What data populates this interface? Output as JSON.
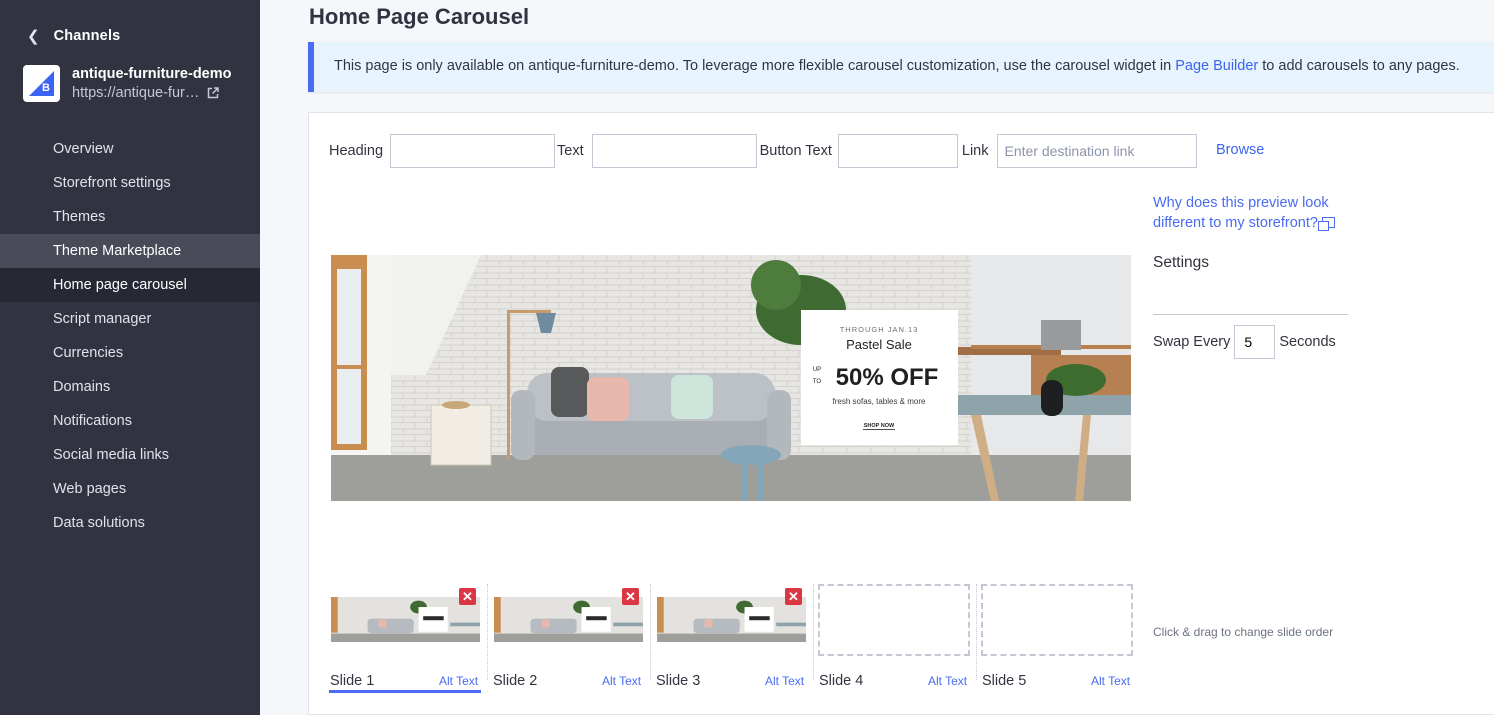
{
  "sidebar": {
    "back_label": "Channels",
    "store_name": "antique-furniture-demo",
    "store_url": "https://antique-fur…",
    "items": [
      {
        "label": "Overview"
      },
      {
        "label": "Storefront settings"
      },
      {
        "label": "Themes"
      },
      {
        "label": "Theme Marketplace"
      },
      {
        "label": "Home page carousel"
      },
      {
        "label": "Script manager"
      },
      {
        "label": "Currencies"
      },
      {
        "label": "Domains"
      },
      {
        "label": "Notifications"
      },
      {
        "label": "Social media links"
      },
      {
        "label": "Web pages"
      },
      {
        "label": "Data solutions"
      }
    ]
  },
  "page": {
    "title": "Home Page Carousel"
  },
  "banner": {
    "text_before": "This page is only available on antique-furniture-demo. To leverage more flexible carousel customization, use the carousel widget in",
    "link": "Page Builder",
    "text_after": "to add carousels to any pages."
  },
  "fields": {
    "heading_label": "Heading",
    "heading_value": "",
    "text_label": "Text",
    "text_value": "",
    "button_text_label": "Button Text",
    "button_text_value": "",
    "link_label": "Link",
    "link_value": "",
    "link_placeholder": "Enter destination link",
    "browse": "Browse"
  },
  "settings": {
    "why_link": "Why does this preview look different to my storefront?",
    "heading": "Settings",
    "swap_label": "Swap Every",
    "swap_value": "5",
    "seconds_label": "Seconds"
  },
  "promo": {
    "through": "THROUGH JAN.13",
    "title": "Pastel Sale",
    "up": "UP",
    "to": "TO",
    "discount": "50% OFF",
    "sub": "fresh sofas, tables & more",
    "cta": "SHOP NOW"
  },
  "slides": [
    {
      "label": "Slide 1",
      "alt": "Alt Text",
      "has_image": true,
      "active": true
    },
    {
      "label": "Slide 2",
      "alt": "Alt Text",
      "has_image": true,
      "active": false
    },
    {
      "label": "Slide 3",
      "alt": "Alt Text",
      "has_image": true,
      "active": false
    },
    {
      "label": "Slide 4",
      "alt": "Alt Text",
      "has_image": false,
      "active": false
    },
    {
      "label": "Slide 5",
      "alt": "Alt Text",
      "has_image": false,
      "active": false
    }
  ],
  "drag_hint": "Click & drag to change slide order",
  "colors": {
    "sidebar": "#313440",
    "accent": "#4a6bf2",
    "delete": "#db3643"
  },
  "icons": {
    "back": "chevron-left-icon",
    "external": "external-link-icon",
    "new_window": "new-window-icon",
    "delete": "close-icon"
  }
}
